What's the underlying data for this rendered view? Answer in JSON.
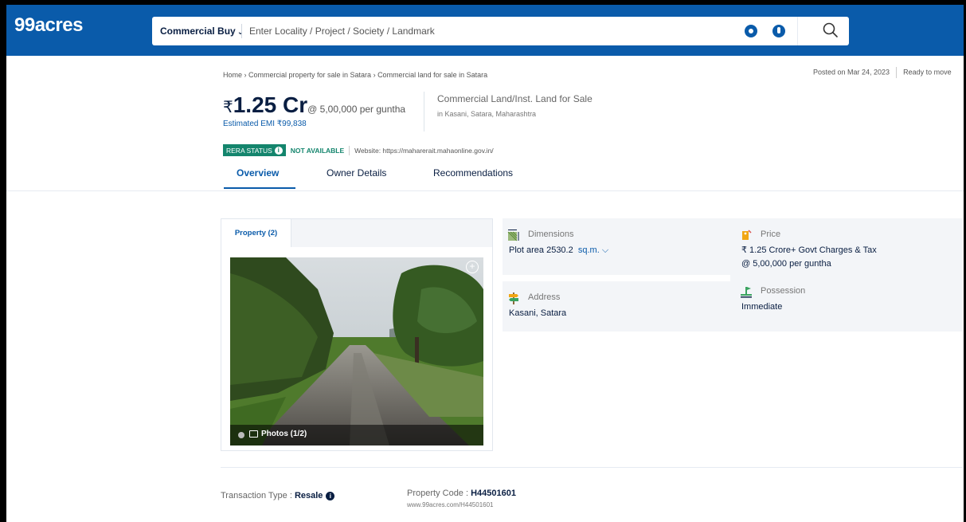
{
  "header": {
    "logo": "99acres",
    "category": "Commercial Buy",
    "search_placeholder": "Enter Locality / Project / Society / Landmark",
    "brand_color": "#0A5BAA"
  },
  "breadcrumb": "Home › Commercial property for sale in Satara › Commercial land for sale in Satara",
  "meta": {
    "posted": "Posted on Mar 24, 2023",
    "status": "Ready to move"
  },
  "listing": {
    "currency": "₹",
    "price": "1.25 Cr",
    "per_unit": "@ 5,00,000 per guntha",
    "emi": "Estimated EMI ₹99,838",
    "type": "Commercial Land/Inst. Land for Sale",
    "location": "in Kasani, Satara, Maharashtra"
  },
  "rera": {
    "label": "RERA STATUS",
    "status": "NOT AVAILABLE",
    "website": "Website: https://maharerait.mahaonline.gov.in/",
    "color": "#14856D"
  },
  "tabs": [
    "Overview",
    "Owner Details",
    "Recommendations"
  ],
  "photos": {
    "tab": "Property (2)",
    "counter": "Photos (1/2)"
  },
  "details": {
    "dimensions": {
      "label": "Dimensions",
      "value": "Plot area 2530.2",
      "unit": "sq.m."
    },
    "price": {
      "label": "Price",
      "value": "₹ 1.25 Crore+ Govt Charges & Tax",
      "value2": "@ 5,00,000 per guntha"
    },
    "address": {
      "label": "Address",
      "value": "Kasani, Satara"
    },
    "possession": {
      "label": "Possession",
      "value": "Immediate"
    }
  },
  "footer": {
    "transaction_label": "Transaction Type : ",
    "transaction_value": "Resale",
    "code_label": "Property Code : ",
    "code_value": "H44501601",
    "code_url": "www.99acres.com/H44501601"
  }
}
